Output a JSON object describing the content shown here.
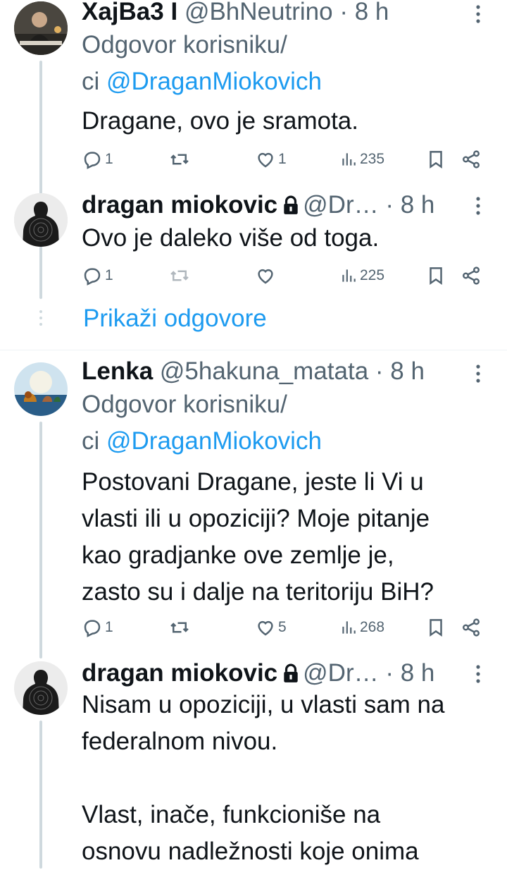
{
  "colors": {
    "accent": "#1d9bf0",
    "text": "#0f1419",
    "muted": "#536471",
    "thread_line": "#cfd9de"
  },
  "tweets": [
    {
      "display_name": "XajBa3 I",
      "handle": "@BhNeutrino",
      "time": "· 8 h",
      "reply_prefix": "Odgovor korisniku/",
      "reply_prefix2": "ci ",
      "reply_to": "@DraganMiokovich",
      "text": "Dragane, ovo je sramota.",
      "stats": {
        "replies": "1",
        "retweets": "",
        "likes": "1",
        "views": "235"
      }
    },
    {
      "display_name": "dragan miokovic",
      "locked": true,
      "handle": "@Dr…",
      "time": "· 8 h",
      "text": "Ovo je daleko više od toga.",
      "stats": {
        "replies": "1",
        "retweets": "",
        "likes": "",
        "views": "225"
      }
    },
    {
      "display_name": "Lenka",
      "handle": "@5hakuna_matata",
      "time": "· 8 h",
      "reply_prefix": "Odgovor korisniku/",
      "reply_prefix2": "ci ",
      "reply_to": "@DraganMiokovich",
      "text_lines": [
        "Postovani Dragane, jeste li Vi u",
        "vlasti ili u opoziciji? Moje pitanje",
        "kao gradjanke ove zemlje je,",
        "zasto su i dalje na teritoriju BiH?"
      ],
      "stats": {
        "replies": "1",
        "retweets": "",
        "likes": "5",
        "views": "268"
      }
    },
    {
      "display_name": "dragan miokovic",
      "locked": true,
      "handle": "@Dr…",
      "time": "· 8 h",
      "text_lines": [
        "Nisam u opoziciji, u vlasti sam na",
        "federalnom nivou.",
        "",
        "Vlast, inače, funkcioniše na",
        "osnovu nadležnosti koje onima"
      ]
    }
  ],
  "show_replies_label": "Prikaži odgovore",
  "icons": [
    "more-icon",
    "reply-icon",
    "retweet-icon",
    "like-icon",
    "views-icon",
    "bookmark-icon",
    "share-icon",
    "lock-icon"
  ]
}
